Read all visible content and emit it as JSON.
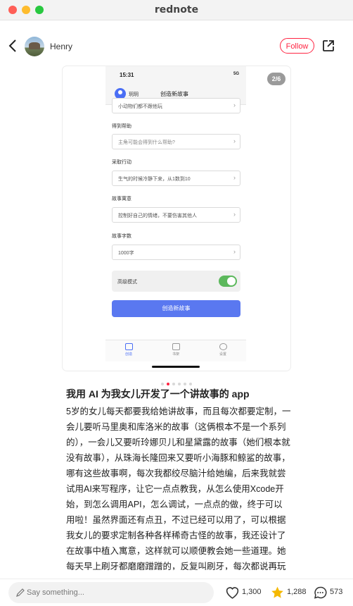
{
  "window": {
    "title": "rednote"
  },
  "header": {
    "username": "Henry",
    "follow_label": "Follow"
  },
  "carousel": {
    "counter": "2/6",
    "current_index": 2,
    "total": 6
  },
  "phone": {
    "time": "15:31",
    "signal": "5G",
    "user": "玥玥",
    "screen_title": "创造新故事",
    "first_field": "小动物们都不跟他玩",
    "sections": [
      {
        "label": "得到帮助",
        "value": "主角可能会得到什么帮助?"
      },
      {
        "label": "采取行动",
        "value": "生气的时候冷静下来，从1数到10"
      },
      {
        "label": "故事寓意",
        "value": "控制好自己的情绪，不要伤害其他人"
      },
      {
        "label": "故事字数",
        "value": "1000字"
      }
    ],
    "advanced_mode_label": "高级模式",
    "advanced_mode_on": true,
    "create_button": "创造新故事",
    "tabs": [
      "创造",
      "书架",
      "设置"
    ]
  },
  "article": {
    "title": "我用 AI 为我女儿开发了一个讲故事的 app",
    "body": "5岁的女儿每天都要我给她讲故事，而且每次都要定制，一会儿要听马里奥和库洛米的故事（这俩根本不是一个系列的），一会儿又要听玲娜贝儿和星黛露的故事（她们根本就没有故事），从珠海长隆回来又要听小海豚和鲸鲨的故事，哪有这些故事啊，每次我都绞尽脑汁给她编，后来我就尝试用AI来写程序，让它一点点教我，从怎么使用Xcode开始，到怎么调用API，怎么调试，一点点的做，终于可以用啦！虽然界面还有点丑，不过已经可以用了，可以根据我女儿的要求定制各种各样稀奇古怪的故事，我还设计了在故事中植入寓意，这样就可以顺便教会她一些道理。她每天早上刷牙都磨磨蹭蹭的，反复叫刷牙，每次都说再玩一会儿，后来我给她编了个牙齿王国细菌大作战的故事，第二天早上她一下就去刷牙了，说要消灭细菌。"
  },
  "bottom": {
    "comment_placeholder": "Say something...",
    "likes": "1,300",
    "stars": "1,288",
    "comments": "573"
  },
  "colors": {
    "brand": "#ff2442",
    "star": "#f5b800",
    "cta": "#5a78f0"
  },
  "icons": [
    "back-arrow-icon",
    "share-icon",
    "pen-icon",
    "heart-icon",
    "star-icon",
    "comment-icon"
  ]
}
